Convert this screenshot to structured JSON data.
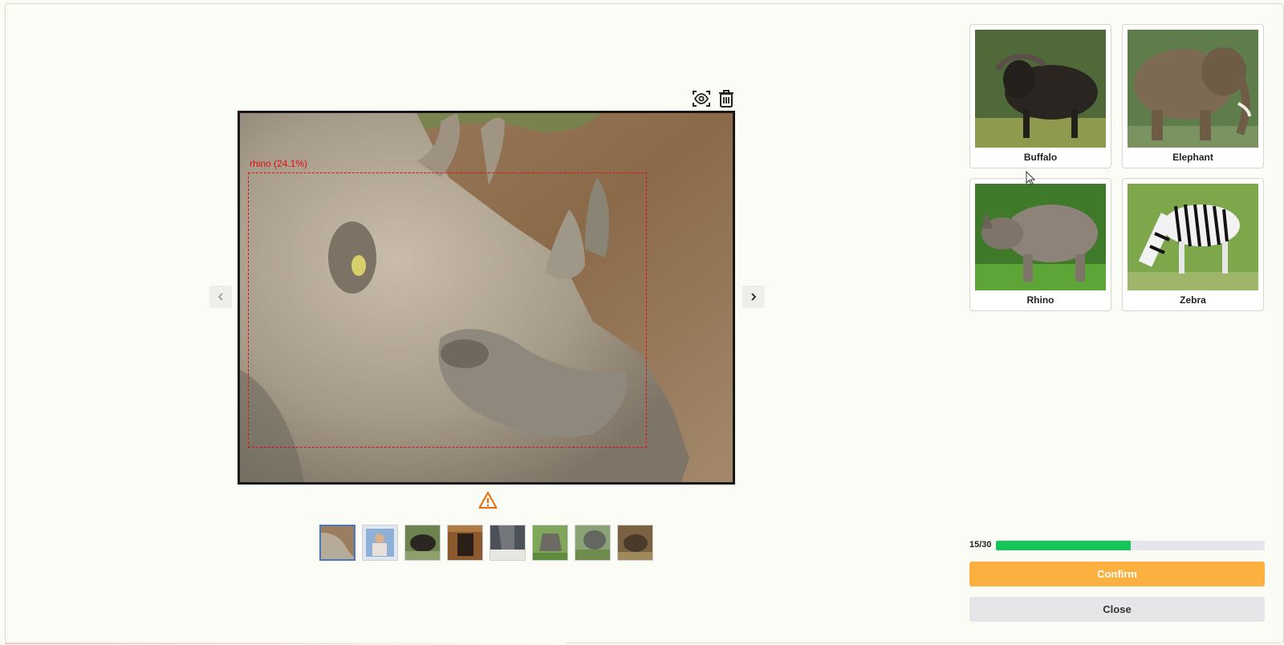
{
  "main_image": {
    "detection_label": "rhino (24.1%)"
  },
  "toolbar": {
    "preview_icon": "eye-scan-icon",
    "delete_icon": "trash-icon"
  },
  "navigation": {
    "prev_icon": "chevron-left-icon",
    "next_icon": "chevron-right-icon"
  },
  "warning_icon": "warning-triangle-icon",
  "thumbnails": [
    {
      "subject": "rhino-head",
      "selected": true
    },
    {
      "subject": "person-with-animal"
    },
    {
      "subject": "buffalo"
    },
    {
      "subject": "dark-animal"
    },
    {
      "subject": "elephant"
    },
    {
      "subject": "rhino-on-grass"
    },
    {
      "subject": "rhino-field"
    },
    {
      "subject": "warthog"
    }
  ],
  "categories": [
    {
      "label": "Buffalo"
    },
    {
      "label": "Elephant"
    },
    {
      "label": "Rhino"
    },
    {
      "label": "Zebra"
    }
  ],
  "progress": {
    "text": "15/30",
    "current": 15,
    "total": 30,
    "color": "#16c55a"
  },
  "buttons": {
    "confirm": "Confirm",
    "close": "Close"
  },
  "colors": {
    "accent": "#fbb040",
    "bbox": "#e01010",
    "thumb_selected": "#4a78b8"
  }
}
